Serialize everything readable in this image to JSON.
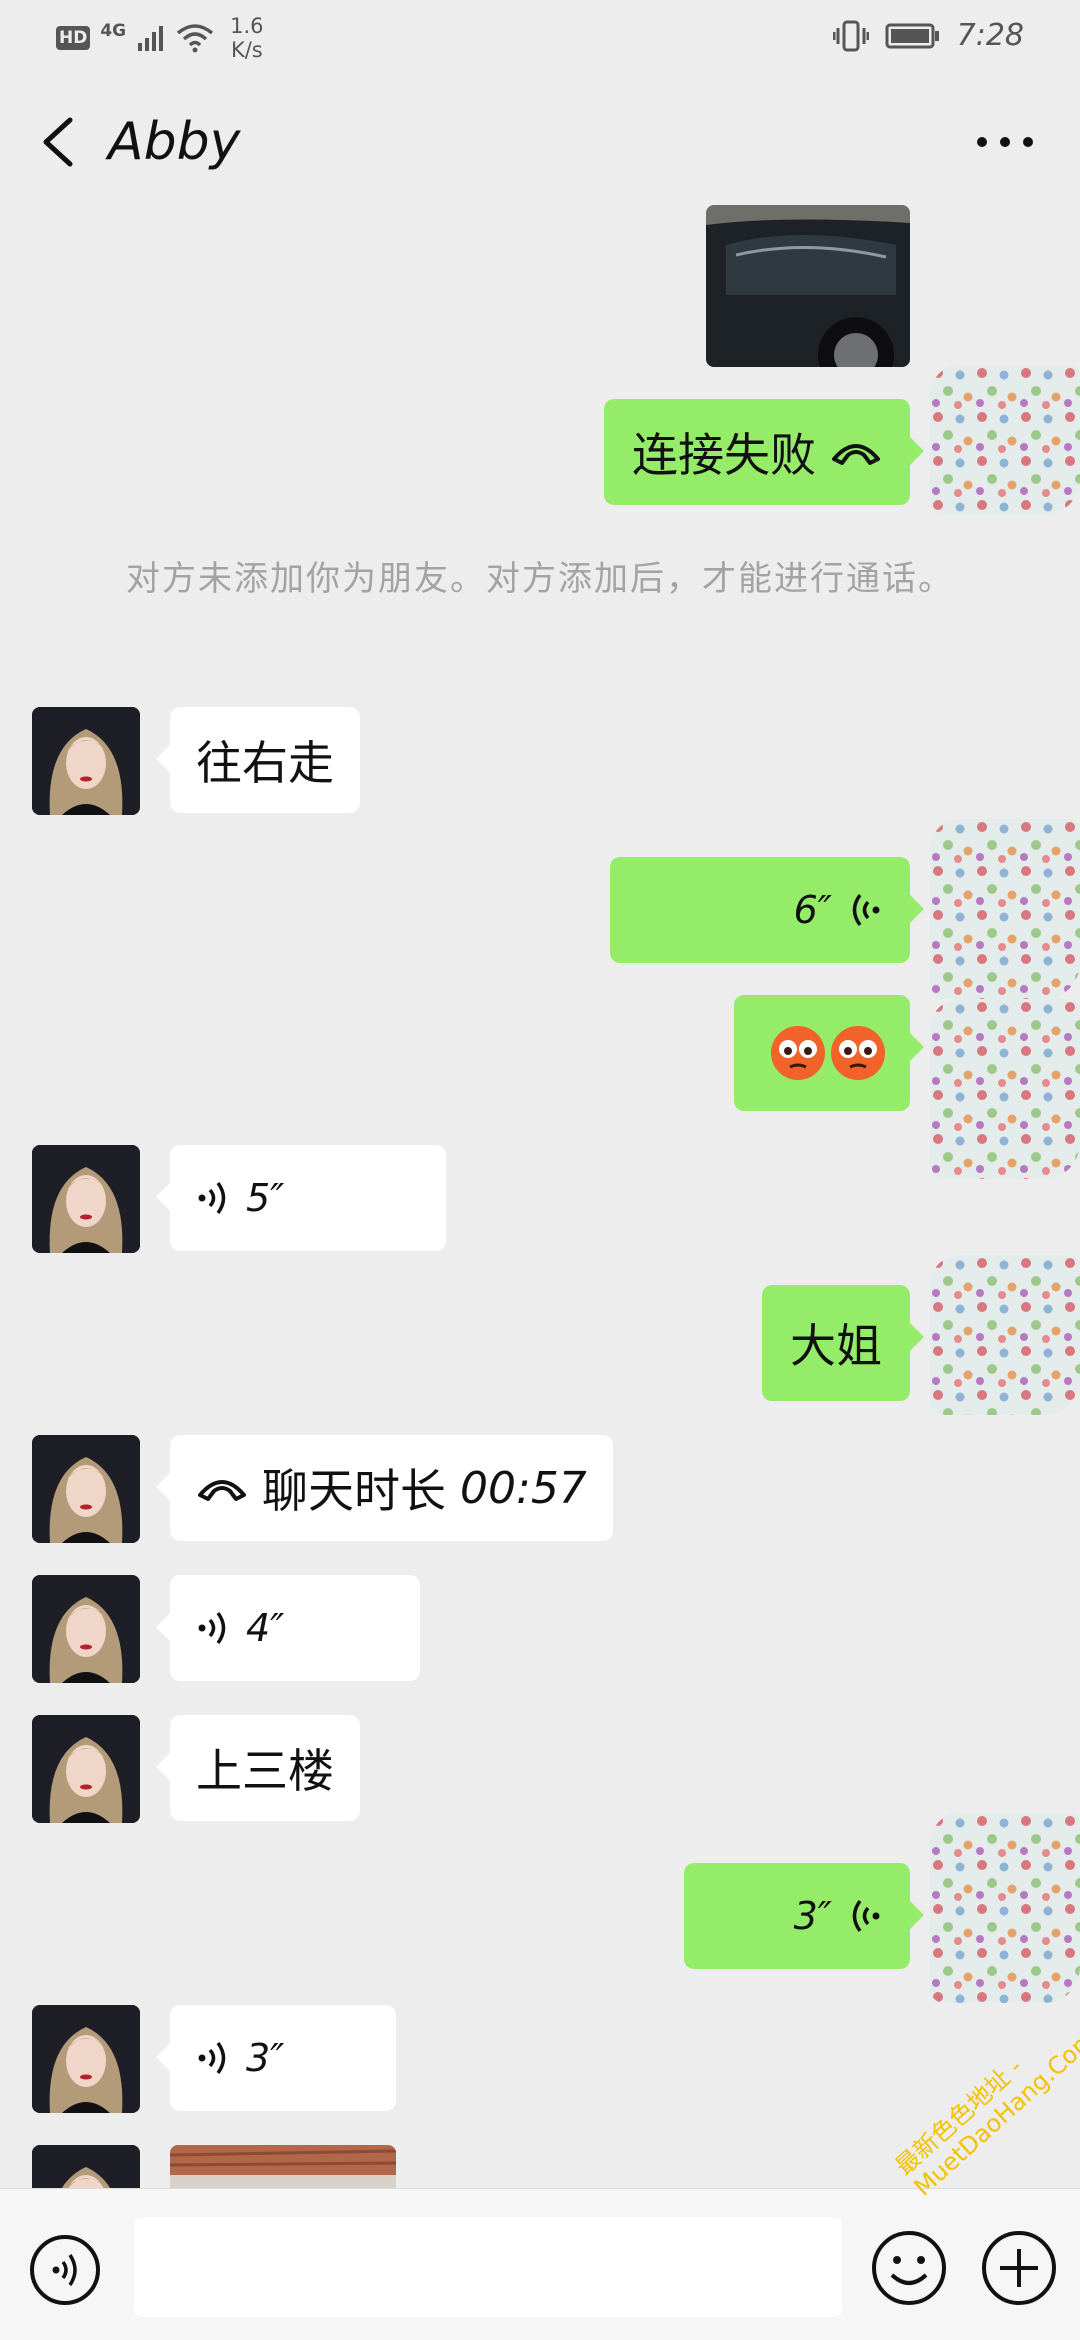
{
  "status_bar": {
    "hd": "HD",
    "network": "4G",
    "speed_value": "1.6",
    "speed_unit": "K/s",
    "time": "7:28",
    "icons": [
      "signal-icon",
      "wifi-icon",
      "vibrate-icon",
      "battery-icon"
    ]
  },
  "header": {
    "title": "Abby",
    "back_icon": "chevron-left-icon",
    "more_icon": "more-dots-icon"
  },
  "messages": [
    {
      "side": "out",
      "type": "image",
      "description_icon": "photo-car"
    },
    {
      "side": "out",
      "type": "call",
      "text": "连接失败",
      "icon": "phone-hangup-icon"
    },
    {
      "side": "system",
      "type": "notice",
      "text": "对方未添加你为朋友。对方添加后，才能进行通话。"
    },
    {
      "side": "in",
      "type": "text",
      "text": "往右走"
    },
    {
      "side": "out",
      "type": "voice",
      "duration": "6″",
      "icon": "voice-wave-icon"
    },
    {
      "side": "out",
      "type": "emoji",
      "icon": "flushed-face-icon",
      "count": 2
    },
    {
      "side": "in",
      "type": "voice",
      "duration": "5″",
      "icon": "voice-wave-icon"
    },
    {
      "side": "out",
      "type": "text",
      "text": "大姐"
    },
    {
      "side": "in",
      "type": "call",
      "text": "聊天时长",
      "duration": "00:57",
      "icon": "phone-hangup-icon"
    },
    {
      "side": "in",
      "type": "voice",
      "duration": "4″",
      "icon": "voice-wave-icon"
    },
    {
      "side": "in",
      "type": "text",
      "text": "上三楼"
    },
    {
      "side": "out",
      "type": "voice",
      "duration": "3″",
      "icon": "voice-wave-icon"
    },
    {
      "side": "in",
      "type": "voice",
      "duration": "3″",
      "icon": "voice-wave-icon"
    },
    {
      "side": "in",
      "type": "image",
      "description_icon": "photo-building"
    }
  ],
  "input_bar": {
    "voice_icon": "voice-mode-icon",
    "placeholder": "",
    "emoji_icon": "emoji-icon",
    "plus_icon": "plus-icon"
  },
  "watermark": {
    "line1": "最新色色地址 -",
    "line2": "MuetDaoHang.Com"
  },
  "colors": {
    "background": "#ededed",
    "outgoing_bubble": "#95ec69",
    "incoming_bubble": "#ffffff",
    "system_text": "#a3a3a3",
    "watermark": "#f2c200"
  }
}
